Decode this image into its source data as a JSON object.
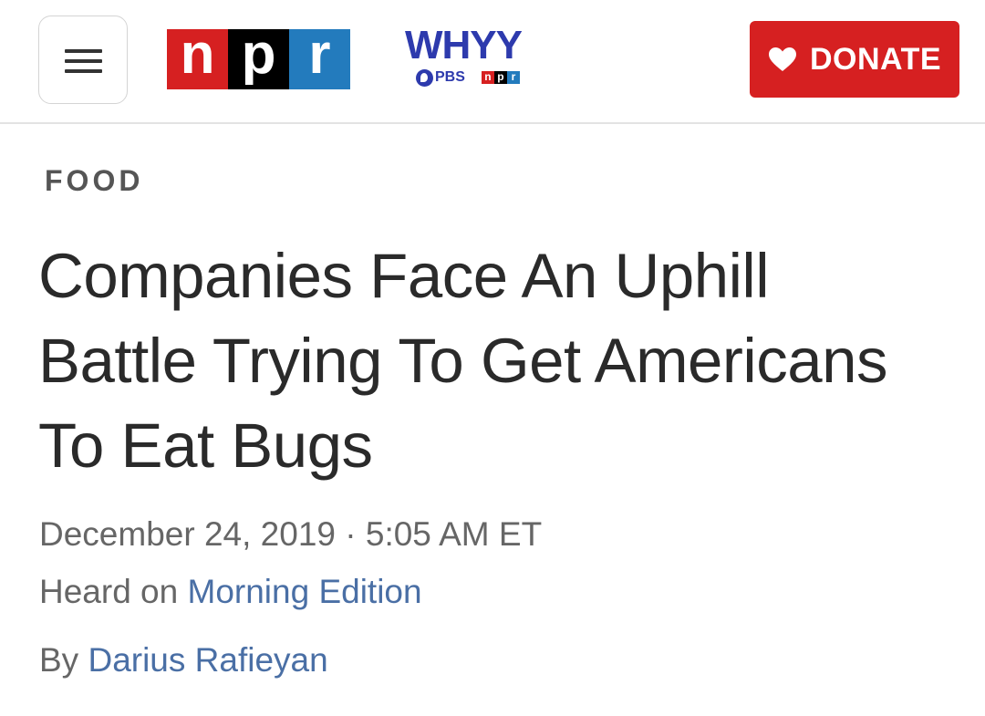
{
  "header": {
    "logo_letters": [
      "n",
      "p",
      "r"
    ],
    "station": {
      "name": "WHYY",
      "pbs_label": "PBS",
      "npr_letters": [
        "n",
        "p",
        "r"
      ]
    },
    "donate_label": "DONATE"
  },
  "article": {
    "section": "FOOD",
    "headline": "Companies Face An Uphill Battle Trying To Get Americans To Eat Bugs",
    "date": "December 24, 2019",
    "separator": "·",
    "time": "5:05 AM ET",
    "heard_on_prefix": "Heard on",
    "program": "Morning Edition",
    "byline_prefix": "By",
    "author": "Darius Rafieyan"
  },
  "colors": {
    "npr_red": "#d62021",
    "npr_black": "#000000",
    "npr_blue": "#237bbd",
    "whyy_blue": "#2d3aad",
    "link_blue": "#4a6fa5",
    "donate_red": "#d62021"
  },
  "icons": {
    "menu": "hamburger-icon",
    "donate": "heart-icon",
    "pbs": "pbs-head-icon"
  }
}
